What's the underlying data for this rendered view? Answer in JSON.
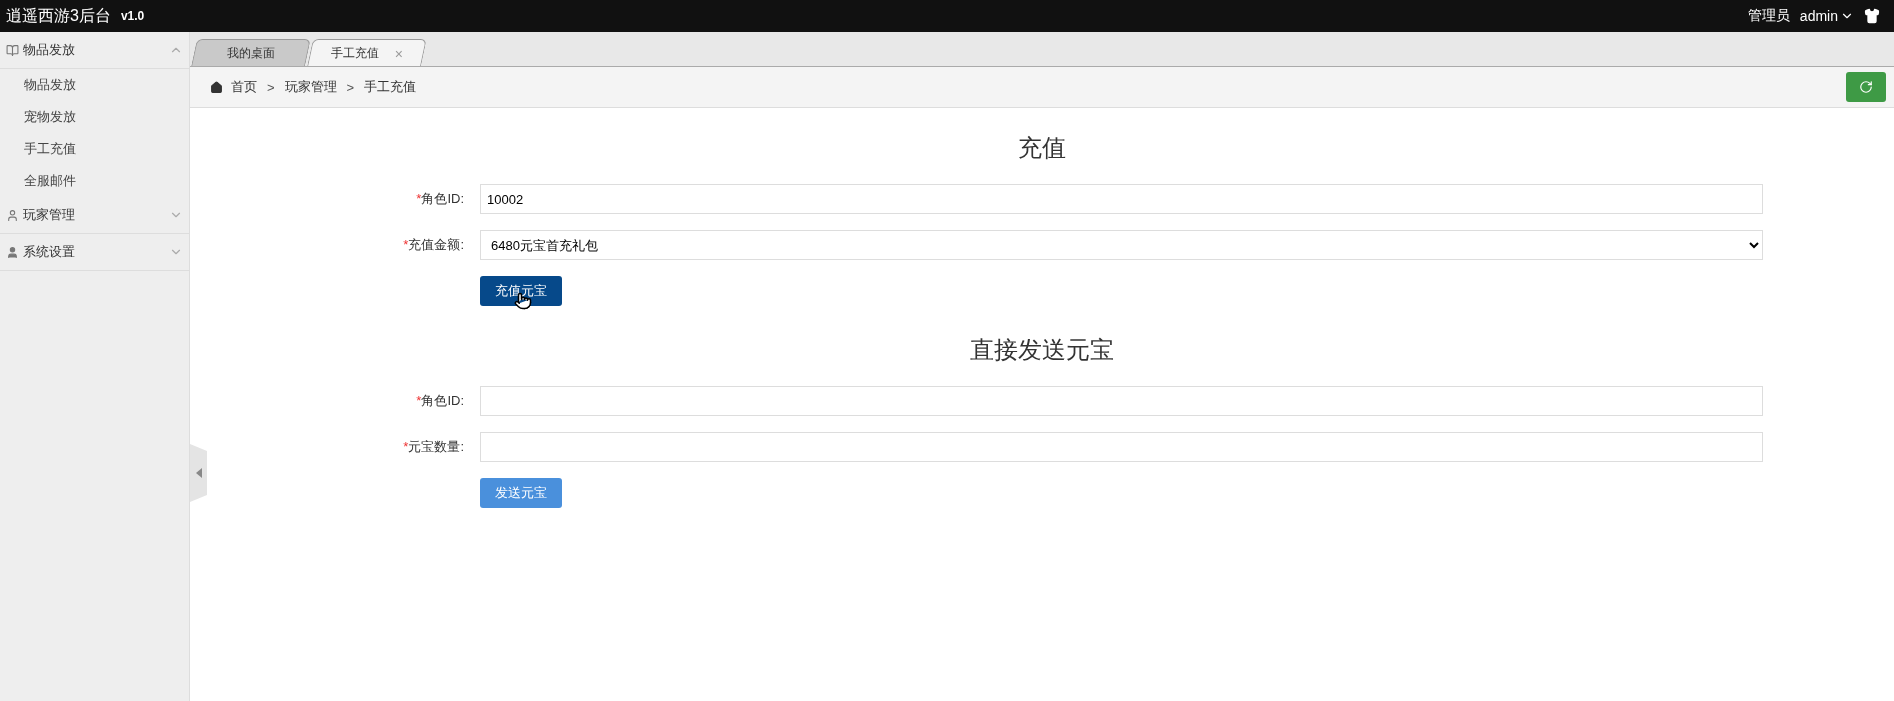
{
  "header": {
    "title": "逍遥西游3后台",
    "version": "v1.0",
    "role": "管理员",
    "user": "admin"
  },
  "sidebar": {
    "groups": [
      {
        "label": "物品发放",
        "expanded": true,
        "items": [
          {
            "label": "物品发放"
          },
          {
            "label": "宠物发放"
          },
          {
            "label": "手工充值"
          },
          {
            "label": "全服邮件"
          }
        ]
      },
      {
        "label": "玩家管理",
        "expanded": false
      },
      {
        "label": "系统设置",
        "expanded": false
      }
    ]
  },
  "tabs": [
    {
      "label": "我的桌面",
      "selected": false
    },
    {
      "label": "手工充值",
      "selected": true,
      "close": "×"
    }
  ],
  "breadcrumb": {
    "separator": ">",
    "items": [
      "首页",
      "玩家管理",
      "手工充值"
    ]
  },
  "sections": [
    {
      "title": "充值",
      "fields": [
        {
          "marker": "*",
          "label": "角色ID:",
          "kind": "input",
          "value": "10002"
        },
        {
          "marker": "*",
          "label": "充值金额:",
          "kind": "select",
          "value": "6480元宝首充礼包"
        }
      ],
      "button": {
        "label": "充值元宝",
        "hovered": true
      }
    },
    {
      "title": "直接发送元宝",
      "fields": [
        {
          "marker": "*",
          "label": "角色ID:",
          "kind": "input"
        },
        {
          "marker": "*",
          "label": "元宝数量:",
          "kind": "input"
        }
      ],
      "button": {
        "label": "发送元宝",
        "hovered": false
      }
    }
  ]
}
